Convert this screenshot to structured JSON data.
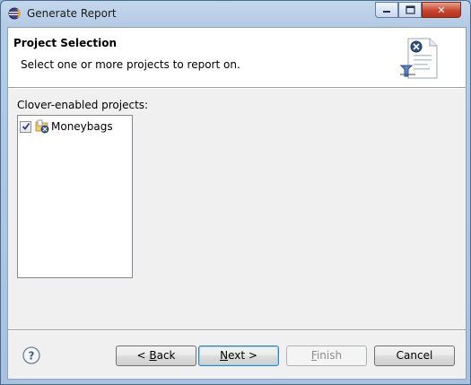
{
  "window": {
    "title": "Generate Report",
    "close_glyph": "✕"
  },
  "header": {
    "title": "Project Selection",
    "description": "Select one or more projects to report on.",
    "banner_icon": "report-wizard-icon"
  },
  "projects": {
    "label": "Clover-enabled projects:",
    "items": [
      {
        "name": "Moneybags",
        "checked": true,
        "icon": "clover-project-icon"
      }
    ]
  },
  "buttons": {
    "back": {
      "prefix": "< ",
      "mnemonic": "B",
      "rest": "ack"
    },
    "next": {
      "mnemonic": "N",
      "rest": "ext >"
    },
    "finish": {
      "mnemonic": "F",
      "rest": "inish",
      "enabled": false
    },
    "cancel": {
      "label": "Cancel"
    }
  },
  "colors": {
    "titlebar": "#b4cbe5",
    "dialog_bg": "#f0f0f0",
    "header_bg": "#ffffff",
    "default_button_border": "#3c7fb1",
    "close_button": "#c9442c"
  }
}
